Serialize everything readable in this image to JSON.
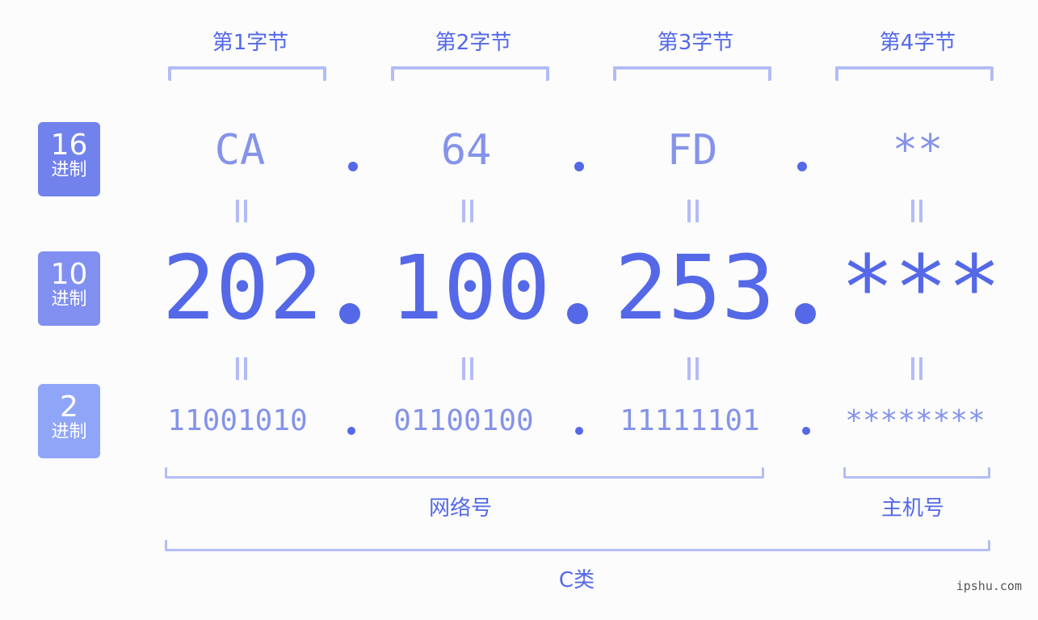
{
  "bytes": [
    {
      "label": "第1字节",
      "hex": "CA",
      "dec": "202",
      "bin": "11001010"
    },
    {
      "label": "第2字节",
      "hex": "64",
      "dec": "100",
      "bin": "01100100"
    },
    {
      "label": "第3字节",
      "hex": "FD",
      "dec": "253",
      "bin": "11111101"
    },
    {
      "label": "第4字节",
      "hex": "**",
      "dec": "***",
      "bin": "********"
    }
  ],
  "badges": {
    "hex": {
      "num": "16",
      "unit": "进制",
      "color": "#7282ec"
    },
    "dec": {
      "num": "10",
      "unit": "进制",
      "color": "#8190f0"
    },
    "bin": {
      "num": "2",
      "unit": "进制",
      "color": "#8fa6f8"
    }
  },
  "segments": {
    "network": "网络号",
    "host": "主机号",
    "class": "C类"
  },
  "watermark": "ipshu.com"
}
